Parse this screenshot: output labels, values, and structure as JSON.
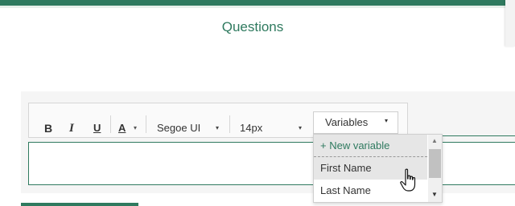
{
  "page": {
    "title": "Questions",
    "accent": "#2f7a5f"
  },
  "toolbar": {
    "bold": "B",
    "italic": "I",
    "underline": "U",
    "font_color": "A",
    "font_color_caret": "▾",
    "font_family": "Segoe UI",
    "font_family_caret": "▾",
    "font_size": "14px",
    "font_size_caret": "▾",
    "variables_label": "Variables",
    "variables_caret": "▾"
  },
  "dropdown": {
    "items": [
      {
        "label": "+ New variable"
      },
      {
        "label": "First Name"
      },
      {
        "label": "Last Name"
      }
    ],
    "scroll_up": "▲",
    "scroll_down": "▼"
  },
  "icons": {
    "cursor": "hand-pointer-icon"
  }
}
